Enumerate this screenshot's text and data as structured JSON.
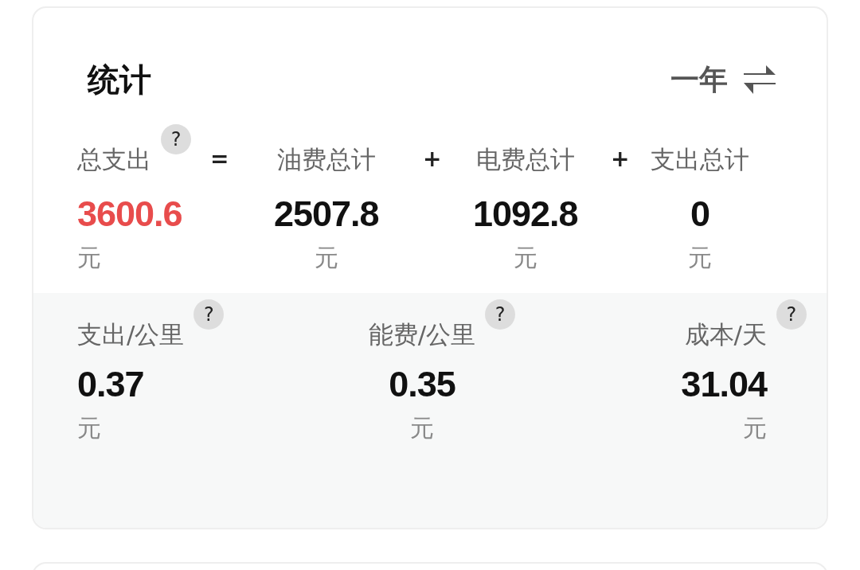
{
  "header": {
    "title": "统计",
    "period": "一年"
  },
  "totals": [
    {
      "label": "总支出",
      "help": "?",
      "value": "3600.6",
      "unit": "元",
      "highlight": true,
      "operator": "="
    },
    {
      "label": "油费总计",
      "value": "2507.8",
      "unit": "元",
      "highlight": false,
      "operator": "+"
    },
    {
      "label": "电费总计",
      "value": "1092.8",
      "unit": "元",
      "highlight": false,
      "operator": "+"
    },
    {
      "label": "支出总计",
      "value": "0",
      "unit": "元",
      "highlight": false
    }
  ],
  "rates": [
    {
      "label": "支出/公里",
      "help": "?",
      "value": "0.37",
      "unit": "元"
    },
    {
      "label": "能费/公里",
      "help": "?",
      "value": "0.35",
      "unit": "元"
    },
    {
      "label": "成本/天",
      "help": "?",
      "value": "31.04",
      "unit": "元"
    }
  ]
}
